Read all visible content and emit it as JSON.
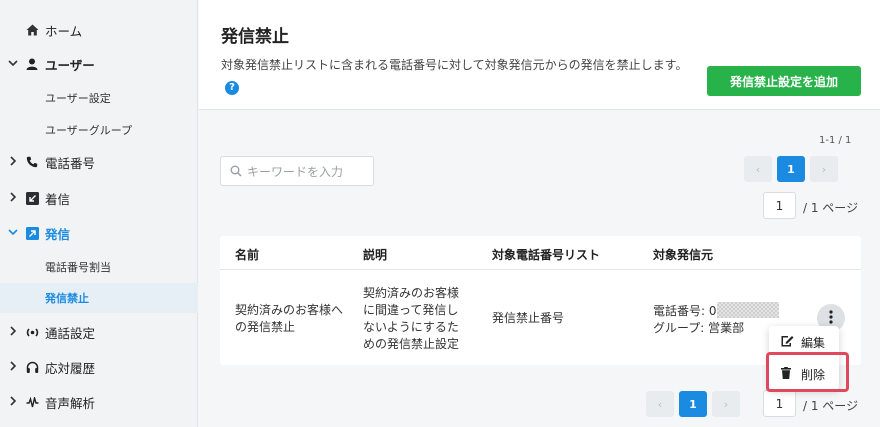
{
  "sidebar": {
    "home": "ホーム",
    "users": "ユーザー",
    "user_settings": "ユーザー設定",
    "user_groups": "ユーザーグループ",
    "phone_numbers": "電話番号",
    "incoming": "着信",
    "outgoing": "発信",
    "number_assignment": "電話番号割当",
    "outgoing_block": "発信禁止",
    "call_settings": "通話設定",
    "history": "応対履歴",
    "voice_analysis": "音声解析"
  },
  "header": {
    "title": "発信禁止",
    "description": "対象発信禁止リストに含まれる電話番号に対して対象発信元からの発信を禁止します。",
    "help_icon": "?",
    "add_button": "発信禁止設定を追加"
  },
  "toolbar": {
    "count": "1-1 / 1",
    "search_placeholder": "キーワードを入力",
    "pagination": {
      "prev": "‹",
      "current": "1",
      "next": "›",
      "page_input": "1",
      "total": "/ 1 ページ"
    }
  },
  "table": {
    "columns": [
      "名前",
      "説明",
      "対象電話番号リスト",
      "対象発信元"
    ],
    "row": {
      "name": "契約済みのお客様への発信禁止",
      "description": "契約済みのお客様に間違って発信しないようにするための発信禁止設定",
      "target_list": "発信禁止番号",
      "source_phone_label": "電話番号: 0",
      "source_group": "グループ: 営業部"
    }
  },
  "context_menu": {
    "edit": "編集",
    "delete": "削除"
  },
  "colors": {
    "accent": "#1a8be0",
    "add_button": "#27b34a",
    "highlight": "#e0485e"
  }
}
